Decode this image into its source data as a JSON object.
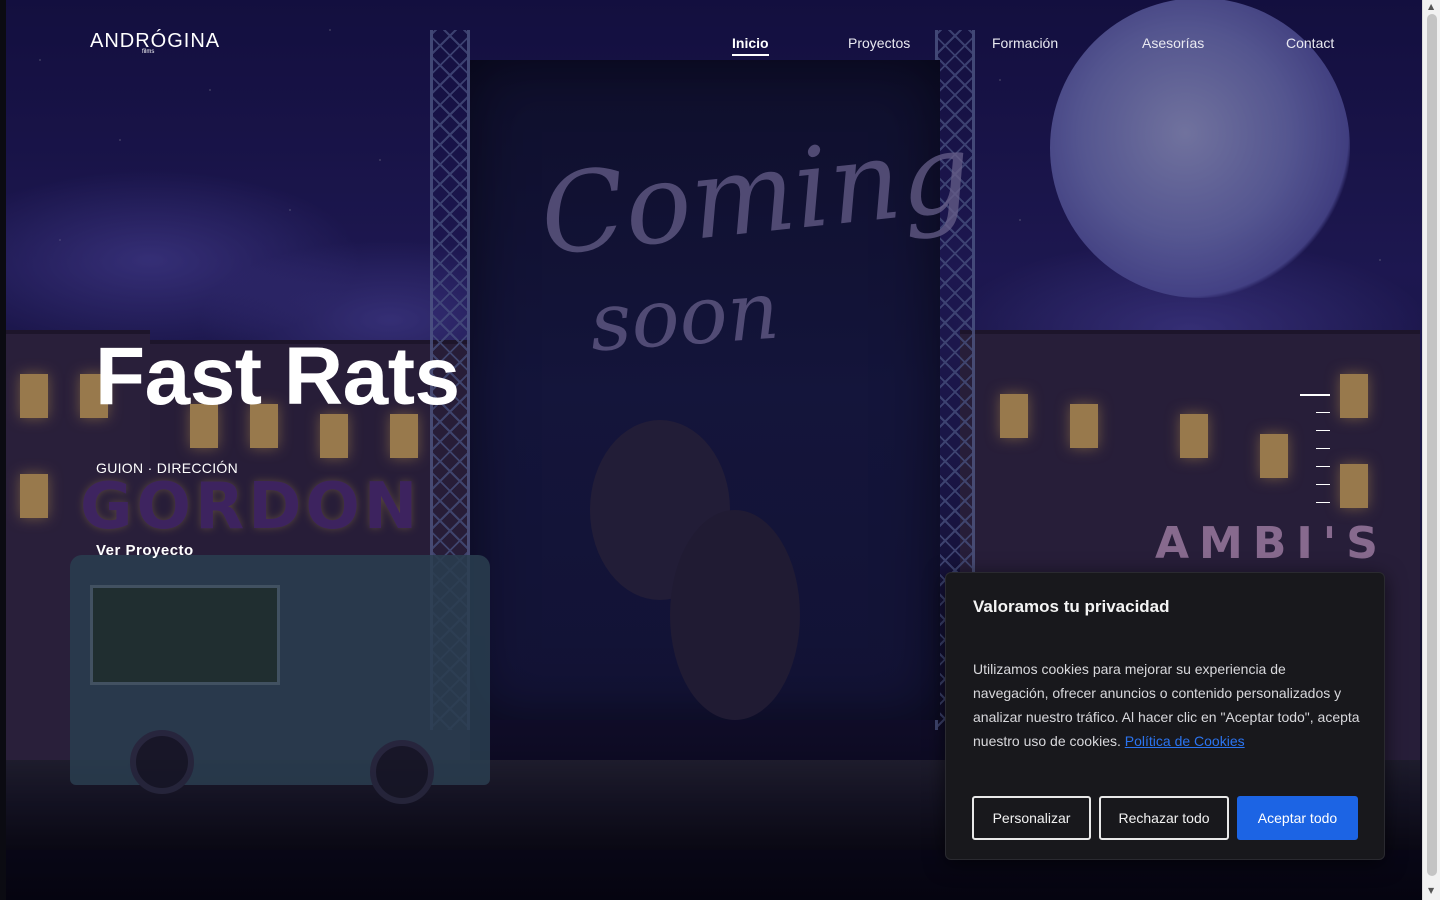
{
  "brand": {
    "logo_text": "ANDRÓGINA",
    "logo_sub": "films"
  },
  "nav": {
    "items": [
      {
        "label": "Inicio",
        "active": true
      },
      {
        "label": "Proyectos",
        "active": false
      },
      {
        "label": "Formación",
        "active": false
      },
      {
        "label": "Asesorías",
        "active": false
      },
      {
        "label": "Contact",
        "active": false
      }
    ]
  },
  "hero": {
    "title": "Fast Rats",
    "subtitle": "GUION · DIRECCIÓN",
    "link_label": "Ver Proyecto",
    "slide_count": 7,
    "active_slide": 1
  },
  "scene": {
    "coming_line1": "Coming",
    "coming_line2": "soon",
    "sign_left": "GORDON",
    "sign_right": "AMBI'S"
  },
  "cookie_banner": {
    "title": "Valoramos tu privacidad",
    "text": "Utilizamos cookies para mejorar su experiencia de navegación, ofrecer anuncios o contenido personalizados y analizar nuestro tráfico. Al hacer clic en \"Aceptar todo\", acepta nuestro uso de cookies.",
    "policy_link": "Política de Cookies",
    "buttons": {
      "customize": "Personalizar",
      "reject": "Rechazar todo",
      "accept": "Aceptar todo"
    }
  },
  "colors": {
    "accent": "#1c64e4",
    "modal_bg": "#18181c",
    "link": "#2b74f0"
  }
}
